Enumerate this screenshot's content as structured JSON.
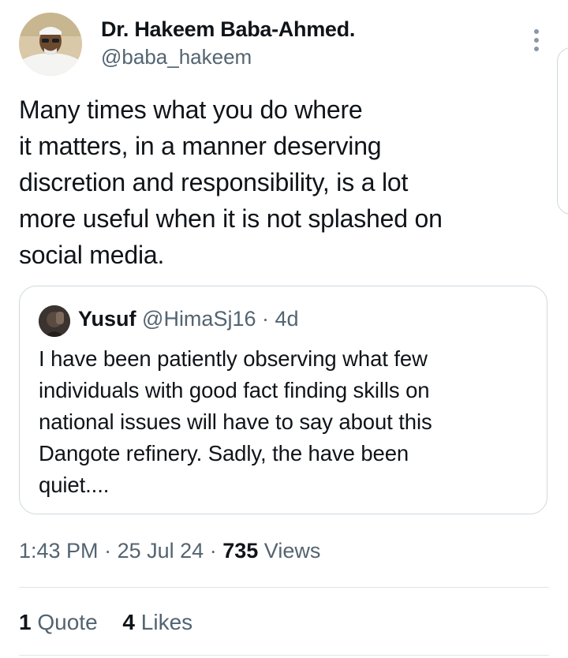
{
  "author": {
    "name": "Dr. Hakeem Baba-Ahmed.",
    "handle": "@baba_hakeem"
  },
  "tweet": {
    "lines": [
      "Many times what you do where",
      "it matters, in a manner deserving",
      "discretion and responsibility, is a lot",
      "more useful when it is not splashed on",
      "social media."
    ]
  },
  "quote": {
    "name": "Yusuf",
    "handle": "@HimaSj16",
    "separator": "·",
    "time": "4d",
    "lines": [
      "I have been patiently observing what few",
      "individuals with good fact finding skills on",
      "national issues will have to say about this",
      "Dangote refinery.  Sadly, the have been",
      "quiet...."
    ]
  },
  "meta": {
    "time": "1:43 PM",
    "date": "25 Jul 24",
    "separator": "·",
    "views_count": "735",
    "views_label": "Views"
  },
  "stats": {
    "quotes_count": "1",
    "quotes_label": "Quote",
    "likes_count": "4",
    "likes_label": "Likes"
  },
  "icons": {
    "more": "more-vertical-icon"
  }
}
